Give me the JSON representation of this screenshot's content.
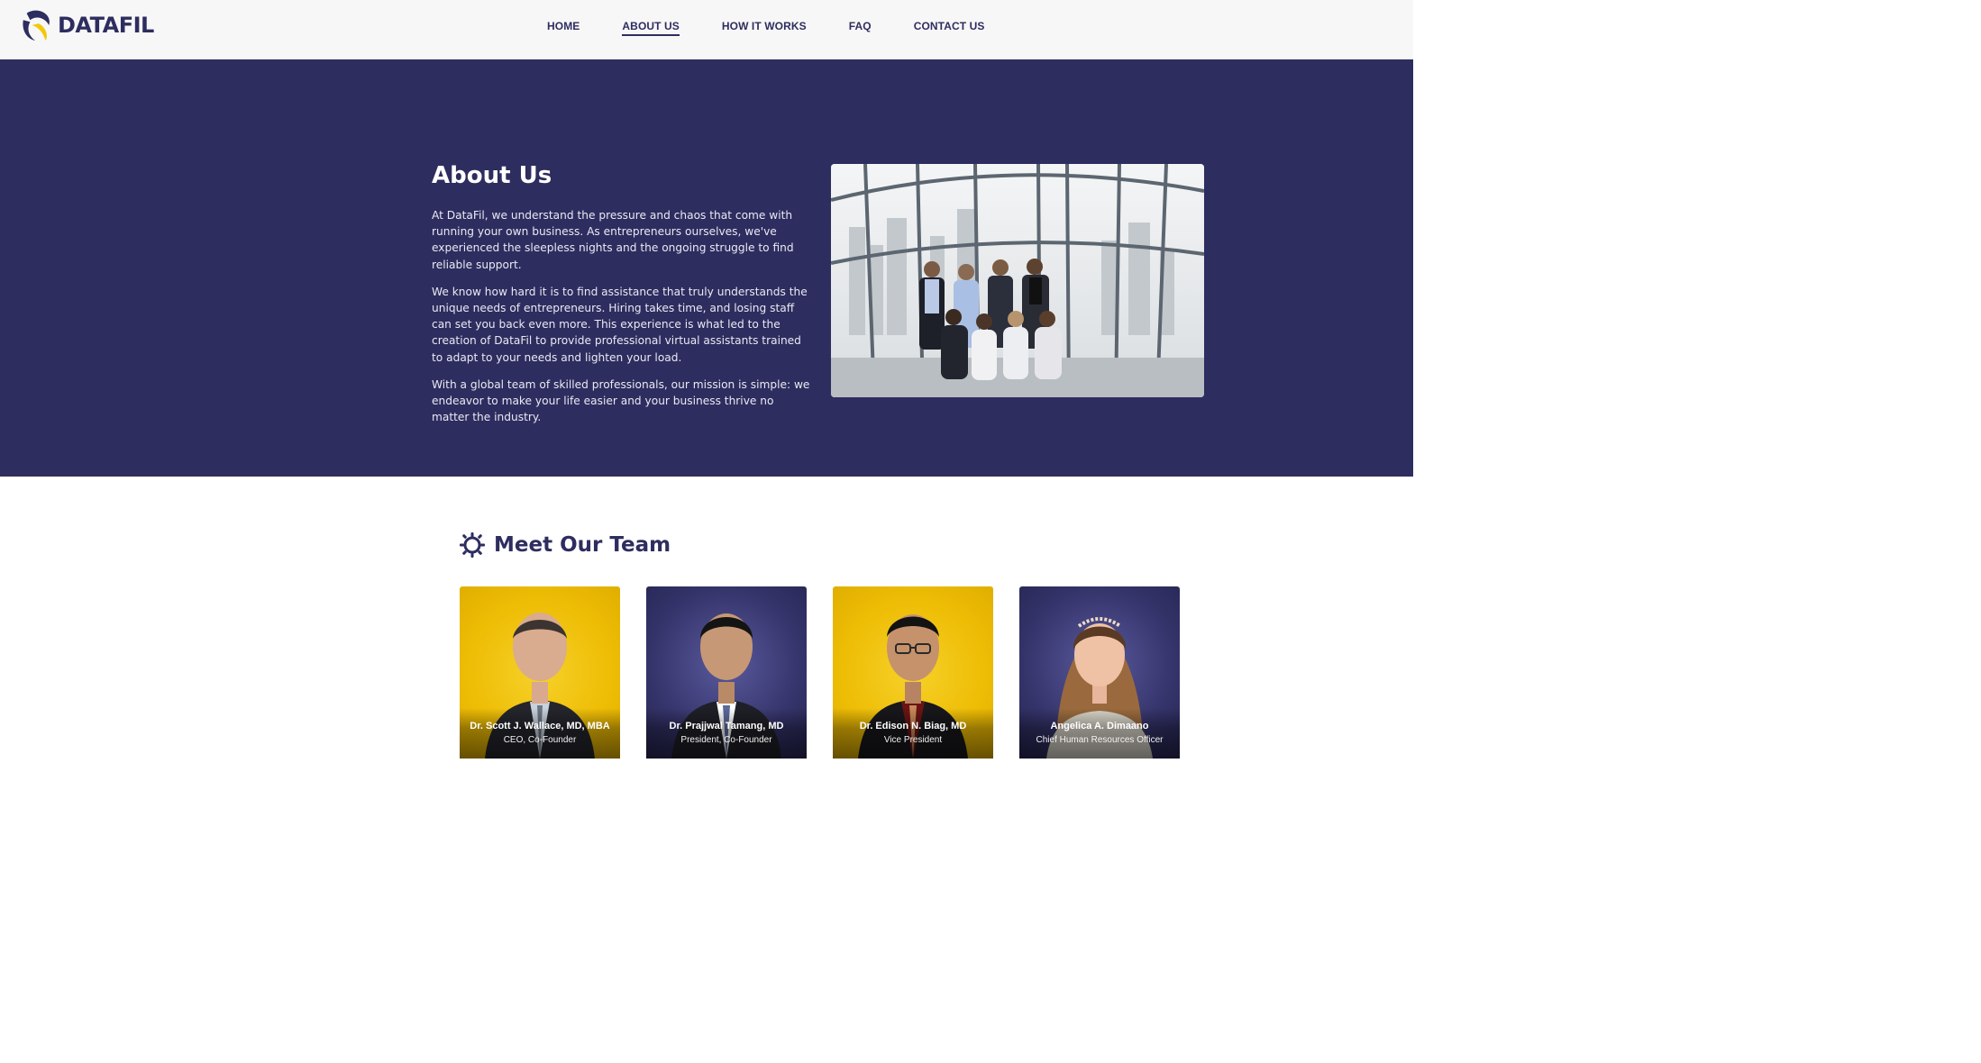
{
  "brand": {
    "name": "DATAFIL",
    "primary": "#2e2d5f",
    "accent": "#f2c80a"
  },
  "nav": {
    "items": [
      {
        "label": "HOME",
        "active": false
      },
      {
        "label": "ABOUT US",
        "active": true
      },
      {
        "label": "HOW IT WORKS",
        "active": false
      },
      {
        "label": "FAQ",
        "active": false
      },
      {
        "label": "CONTACT US",
        "active": false
      }
    ]
  },
  "about": {
    "title": "About Us",
    "paragraphs": [
      "At DataFil, we understand the pressure and chaos that come with running your own business. As entrepreneurs ourselves, we've experienced the sleepless nights and the ongoing struggle to find reliable support.",
      "We know how hard it is to find assistance that truly understands the unique needs of entrepreneurs. Hiring takes time, and losing staff can set you back even more. This experience is what led to the creation of DataFil to provide professional virtual assistants trained to adapt to your needs and lighten your load.",
      "With a global team of skilled professionals, our mission is simple: we endeavor to make your life easier and your business thrive no matter the industry."
    ]
  },
  "team": {
    "heading": "Meet Our Team",
    "heading_icon": "gear-icon",
    "members": [
      {
        "name": "Dr. Scott J. Wallace, MD, MBA",
        "role": "CEO, Co-Founder",
        "background": "yellow"
      },
      {
        "name": "Dr. Prajjwal Tamang, MD",
        "role": "President, Co-Founder",
        "background": "navy"
      },
      {
        "name": "Dr. Edison N. Biag, MD",
        "role": "Vice President",
        "background": "yellow"
      },
      {
        "name": "Angelica A. Dimaano",
        "role": "Chief Human Resources Officer",
        "background": "navy"
      }
    ]
  }
}
